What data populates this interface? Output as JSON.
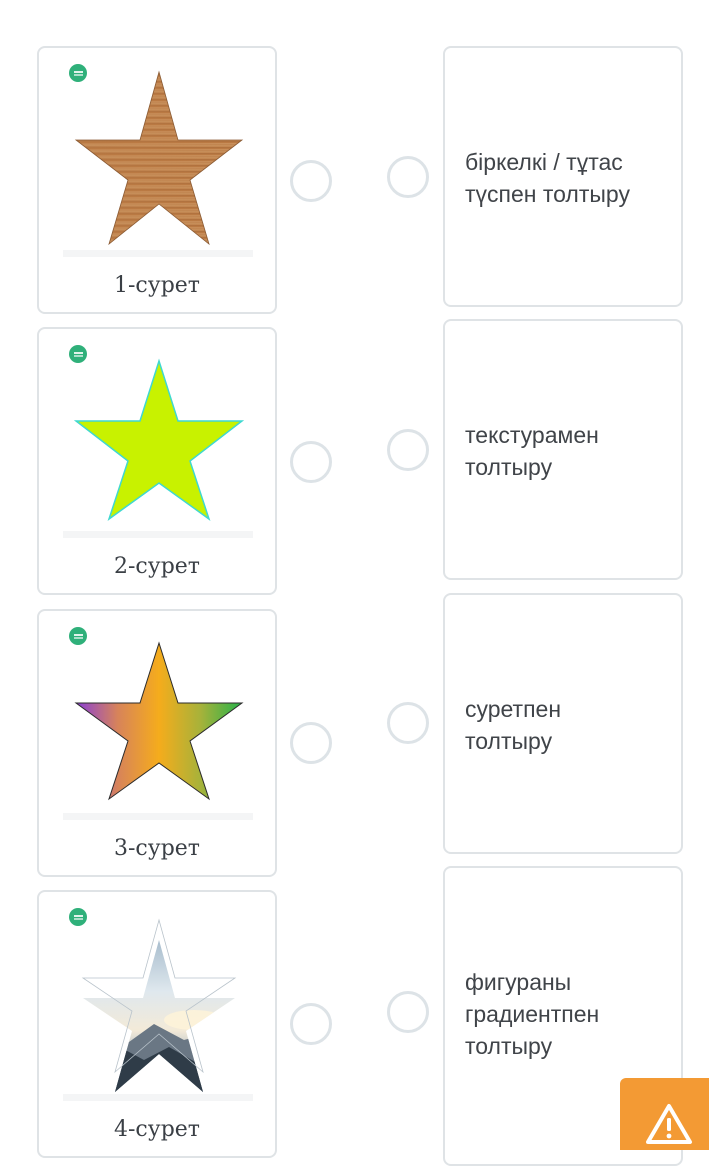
{
  "colors": {
    "card_border": "#dfe3e6",
    "radio_border": "#dde3e7",
    "badge_green": "#2fb07a",
    "alert_orange": "#f39a34",
    "star_lime": "#c8f200",
    "star_lime_outline": "#3fd8d0"
  },
  "image_cards": [
    {
      "caption": "1-сурет",
      "star_fill": "wood-texture"
    },
    {
      "caption": "2-сурет",
      "star_fill": "solid-lime"
    },
    {
      "caption": "3-сурет",
      "star_fill": "gradient"
    },
    {
      "caption": "4-сурет",
      "star_fill": "photo-sky-mountains"
    }
  ],
  "text_cards": [
    {
      "lines": [
        "біркелкі / тұтас",
        "түспен толтыру"
      ]
    },
    {
      "lines": [
        "текстурамен",
        "толтыру"
      ]
    },
    {
      "lines": [
        "суретпен",
        "толтыру"
      ]
    },
    {
      "lines": [
        "фигураны",
        "градиентпен",
        "толтыру"
      ]
    }
  ],
  "alert_button": {
    "icon": "warning-icon"
  }
}
